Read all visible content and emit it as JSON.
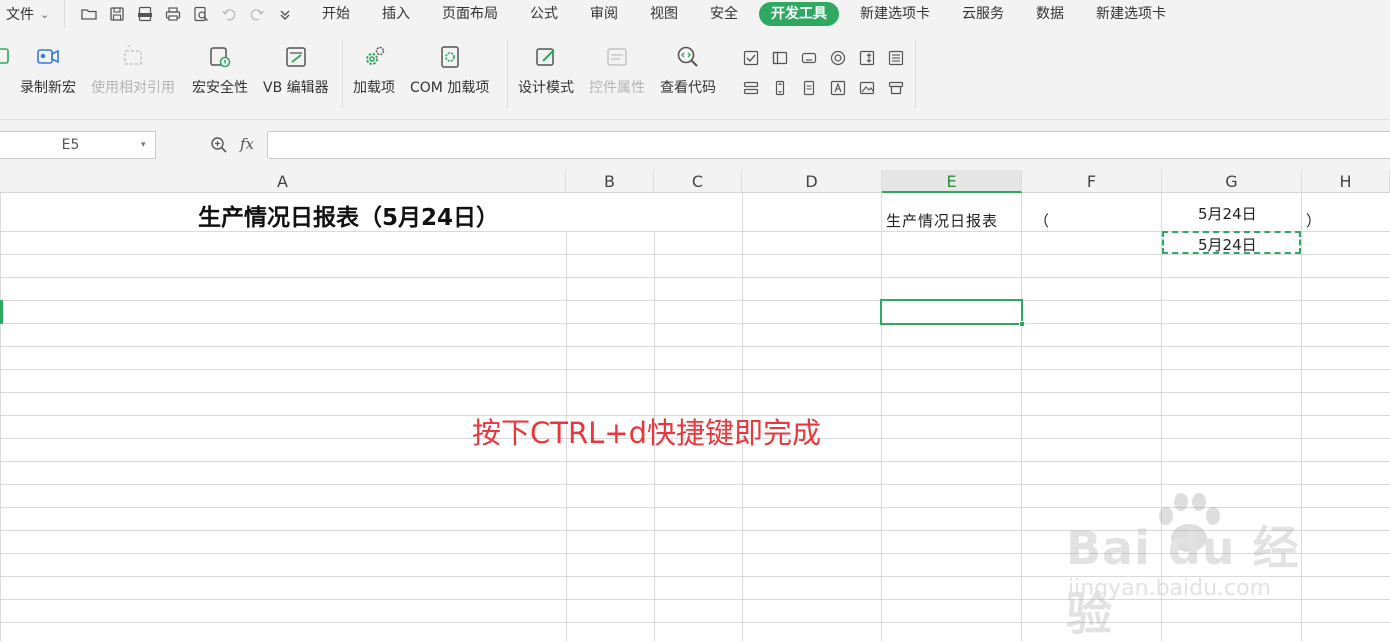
{
  "menubar": {
    "file_label": "文件",
    "quick_access_icons": [
      "open-folder-icon",
      "save-icon",
      "pdf-icon",
      "print-icon",
      "print-preview-icon",
      "undo-icon",
      "redo-icon",
      "customize-dropdown-icon"
    ],
    "tabs": [
      {
        "label": "开始",
        "active": false
      },
      {
        "label": "插入",
        "active": false
      },
      {
        "label": "页面布局",
        "active": false
      },
      {
        "label": "公式",
        "active": false
      },
      {
        "label": "审阅",
        "active": false
      },
      {
        "label": "视图",
        "active": false
      },
      {
        "label": "安全",
        "active": false
      },
      {
        "label": "开发工具",
        "active": true
      },
      {
        "label": "新建选项卡",
        "active": false
      },
      {
        "label": "云服务",
        "active": false
      },
      {
        "label": "数据",
        "active": false
      },
      {
        "label": "新建选项卡",
        "active": false
      }
    ],
    "active_color": "#2fa862"
  },
  "ribbon": {
    "buttons": [
      {
        "label": "录制新宏",
        "icon": "record-macro-icon",
        "enabled": true
      },
      {
        "label": "使用相对引用",
        "icon": "relative-reference-icon",
        "enabled": false
      },
      {
        "label": "宏安全性",
        "icon": "macro-security-icon",
        "enabled": true
      },
      {
        "label": "VB 编辑器",
        "icon": "vb-editor-icon",
        "enabled": true
      },
      {
        "label": "加载项",
        "icon": "addins-gear-icon",
        "enabled": true
      },
      {
        "label": "COM 加载项",
        "icon": "com-addins-icon",
        "enabled": true
      },
      {
        "label": "设计模式",
        "icon": "design-mode-icon",
        "enabled": true
      },
      {
        "label": "控件属性",
        "icon": "control-properties-icon",
        "enabled": false
      },
      {
        "label": "查看代码",
        "icon": "view-code-icon",
        "enabled": true
      }
    ],
    "controls_row1": [
      "checkbox-control-icon",
      "frame-control-icon",
      "button-control-icon",
      "radio-control-icon",
      "spin-control-icon",
      "listbox-control-icon"
    ],
    "controls_row2": [
      "combobox-control-icon",
      "scrollbar-control-icon",
      "textbox-control-icon",
      "label-control-icon",
      "image-control-icon",
      "more-controls-icon"
    ]
  },
  "formula_bar": {
    "name_box": "E5",
    "fx_label": "fx",
    "formula": ""
  },
  "sheet": {
    "columns": [
      "A",
      "B",
      "C",
      "D",
      "E",
      "F",
      "G",
      "H"
    ],
    "selected_column": "E",
    "cells": {
      "A1": "生产情况日报表（5月24日）",
      "E1": "生产情况日报表",
      "F1": "（",
      "G1": "5月24日",
      "H1": "）",
      "G2": "5月24日"
    },
    "active_cell": "E5",
    "copied_cell": "G2",
    "annotation": "按下CTRL+d快捷键即完成",
    "annotation_color": "#e8383d"
  },
  "watermark": {
    "brand": "Bai du 经验",
    "site": "jingyan.baidu.com"
  }
}
